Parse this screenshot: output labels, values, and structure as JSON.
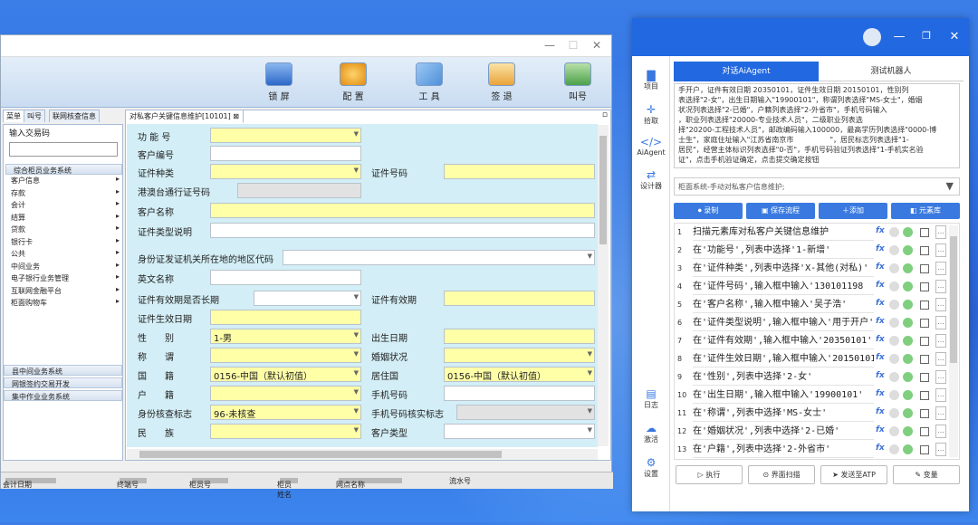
{
  "teller": {
    "ribbon": [
      "锁 屏",
      "配 置",
      "工 具",
      "签 退",
      "叫号"
    ],
    "left_tabs": [
      "菜单",
      "叫号",
      "联网核查信息"
    ],
    "content_tab": "对私客户关键信息维护[10101]",
    "sidebar": {
      "input_label": "输入交易码",
      "group": "综合柜员业务系统",
      "items": [
        "客户信息",
        "存款",
        "会计",
        "结算",
        "贷款",
        "银行卡",
        "公共",
        "中间业务",
        "电子银行业务管理",
        "互联网金融平台",
        "柜面购物车"
      ],
      "bottom_groups": [
        "县中间业务系统",
        "网银签约交易开发",
        "集中作业业务系统"
      ]
    },
    "form": {
      "func_no": "功 能 号",
      "cust_no": "客户编号",
      "cert_type": "证件种类",
      "cert_no": "证件号码",
      "hk_permit": "港澳台通行证号码",
      "cust_name": "客户名称",
      "cert_desc": "证件类型说明",
      "region": "身份证发证机关所在地的地区代码",
      "en_name": "英文名称",
      "long_term": "证件有效期是否长期",
      "cert_valid": "证件有效期",
      "cert_start": "证件生效日期",
      "gender": "性　　别",
      "gender_val": "1-男",
      "birth": "出生日期",
      "title": "称　　谓",
      "marital": "婚姻状况",
      "nation": "国　　籍",
      "nation_val": "0156-中国（默认初值）",
      "residence": "居住国",
      "residence_val": "0156-中国（默认初值）",
      "huji": "户　　籍",
      "phone": "手机号码",
      "check_flag": "身份核查标志",
      "check_val": "96-未核查",
      "phone_check": "手机号码核实标志",
      "ethnic": "民　　族",
      "cust_type": "客户类型"
    },
    "status": [
      "会计日期",
      "终端号",
      "柜员号",
      "柜员姓名",
      "网点名称",
      "流水号"
    ]
  },
  "agent": {
    "sidebar": [
      "项目",
      "拾取",
      "AiAgent",
      "设计器",
      "日志",
      "激活",
      "设置"
    ],
    "tabs": [
      "对话AiAgent",
      "测试机器人"
    ],
    "text": [
      "手开户，证件有效日期 20350101，证件生效日期 20150101，性别列",
      "表选择\"2-女\"，出生日期输入\"19900101\"，称谓列表选择\"MS-女士\"，婚姻",
      "状况列表选择\"2-已婚\"，户籍列表选择\"2-外省市\"，手机号码输入",
      "，职业列表选择\"20000-专业技术人员\"，二级职业列表选",
      "择\"20200-工程技术人员\"，邮政编码输入100000，最高学历列表选择\"0000-博",
      "士生\"，家庭住址输入\"江苏省南京市　　　　　\"，居民标志列表选择\"1-",
      "居民\"，经营主体标识列表选择\"0-否\"，手机号码验证列表选择\"1-手机实名验",
      "证\"，点击手机验证确定，点击提交确定按钮"
    ],
    "path": "柜面系统-手动对私客户信息维护;",
    "toolbar": [
      "录制",
      "保存流程",
      "添加",
      "元素库"
    ],
    "steps": [
      "扫描元素库对私客户关键信息维护",
      "在'功能号',列表中选择'1-新增'",
      "在'证件种类',列表中选择'X-其他(对私)'",
      "在'证件号码',输入框中输入'130101198",
      "在'客户名称',输入框中输入'吴子浩'",
      "在'证件类型说明',输入框中输入'用于开户'",
      "在'证件有效期',输入框中输入'20350101'",
      "在'证件生效日期',输入框中输入'20150101'",
      "在'性别',列表中选择'2-女'",
      "在'出生日期',输入框中输入'19900101'",
      "在'称谓',列表中选择'MS-女士'",
      "在'婚姻状况',列表中选择'2-已婚'",
      "在'户籍',列表中选择'2-外省市'"
    ],
    "bottom": [
      "执行",
      "界面扫描",
      "发送至ATP",
      "变量"
    ]
  }
}
